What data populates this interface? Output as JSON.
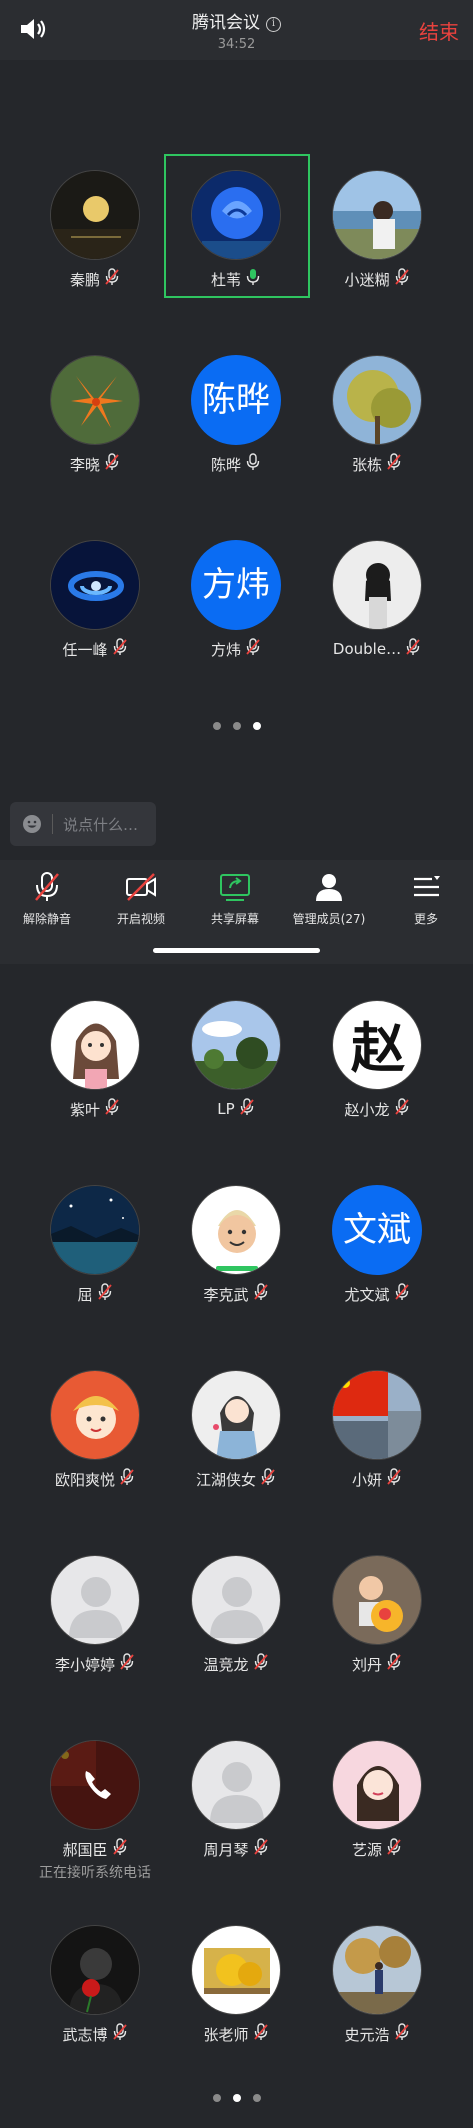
{
  "header": {
    "title": "腾讯会议",
    "timer": "34:52",
    "end_label": "结束",
    "speaker_icon": "speaker-icon",
    "info_icon": "info-icon"
  },
  "page1": {
    "participants": [
      {
        "name": "秦鹏",
        "mic": "muted",
        "avatar": "moon-photo"
      },
      {
        "name": "杜苇",
        "mic": "active",
        "avatar": "blue-rose-photo",
        "highlighted": true
      },
      {
        "name": "小迷糊",
        "mic": "muted",
        "avatar": "seaside-girl-photo"
      },
      {
        "name": "李晓",
        "mic": "muted",
        "avatar": "lily-photo"
      },
      {
        "name": "陈晔",
        "mic": "unmuted",
        "avatar_text": "陈晔"
      },
      {
        "name": "张栋",
        "mic": "muted",
        "avatar": "tree-photo"
      },
      {
        "name": "任一峰",
        "mic": "muted",
        "avatar": "galaxy-photo"
      },
      {
        "name": "方炜",
        "mic": "muted",
        "avatar_text": "方炜"
      },
      {
        "name": "Double…",
        "mic": "muted",
        "avatar": "girl-white-photo"
      }
    ],
    "pager": {
      "count": 3,
      "active": 3
    }
  },
  "chat": {
    "placeholder": "说点什么…",
    "emoji_icon": "emoji-icon"
  },
  "toolbar": {
    "items": [
      {
        "label": "解除静音",
        "icon": "mic-muted-icon"
      },
      {
        "label": "开启视频",
        "icon": "video-off-icon"
      },
      {
        "label": "共享屏幕",
        "icon": "share-screen-icon"
      },
      {
        "label": "管理成员(27)",
        "icon": "members-icon"
      },
      {
        "label": "更多",
        "icon": "more-menu-icon"
      }
    ]
  },
  "page2": {
    "participants": [
      {
        "name": "紫叶",
        "mic": "muted",
        "avatar": "cartoon-girl"
      },
      {
        "name": "LP",
        "mic": "muted",
        "avatar": "sky-trees-photo"
      },
      {
        "name": "赵小龙",
        "mic": "muted",
        "avatar": "calligraphy-zhao"
      },
      {
        "name": "屈",
        "mic": "muted",
        "avatar": "starry-lake-photo"
      },
      {
        "name": "李克武",
        "mic": "muted",
        "avatar": "memoji-man"
      },
      {
        "name": "尤文斌",
        "mic": "muted",
        "avatar_text": "文斌"
      },
      {
        "name": "欧阳爽悦",
        "mic": "muted",
        "avatar": "cartoon-child"
      },
      {
        "name": "江湖侠女",
        "mic": "muted",
        "avatar": "cartoon-lady"
      },
      {
        "name": "小妍",
        "mic": "muted",
        "avatar": "flag-photo"
      },
      {
        "name": "李小婷婷",
        "mic": "muted",
        "avatar": "default-avatar"
      },
      {
        "name": "温竞龙",
        "mic": "muted",
        "avatar": "default-avatar"
      },
      {
        "name": "刘丹",
        "mic": "muted",
        "avatar": "child-toy-photo"
      },
      {
        "name": "郝国臣",
        "mic": "muted",
        "avatar": "phone-call",
        "status": "正在接听系统电话"
      },
      {
        "name": "周月琴",
        "mic": "muted",
        "avatar": "default-avatar"
      },
      {
        "name": "艺源",
        "mic": "muted",
        "avatar": "woman-portrait"
      },
      {
        "name": "武志博",
        "mic": "muted",
        "avatar": "man-rose-photo"
      },
      {
        "name": "张老师",
        "mic": "muted",
        "avatar": "yellow-tree-photo"
      },
      {
        "name": "史元浩",
        "mic": "muted",
        "avatar": "autumn-person-photo"
      }
    ],
    "pager": {
      "count": 3,
      "active": 2
    }
  },
  "colors": {
    "background": "#25272b",
    "bar": "#2b2d31",
    "accent_blue": "#0a6cf3",
    "end_red": "#e8423e",
    "speaking_green": "#2fc560",
    "mute_red": "#e8423e"
  }
}
